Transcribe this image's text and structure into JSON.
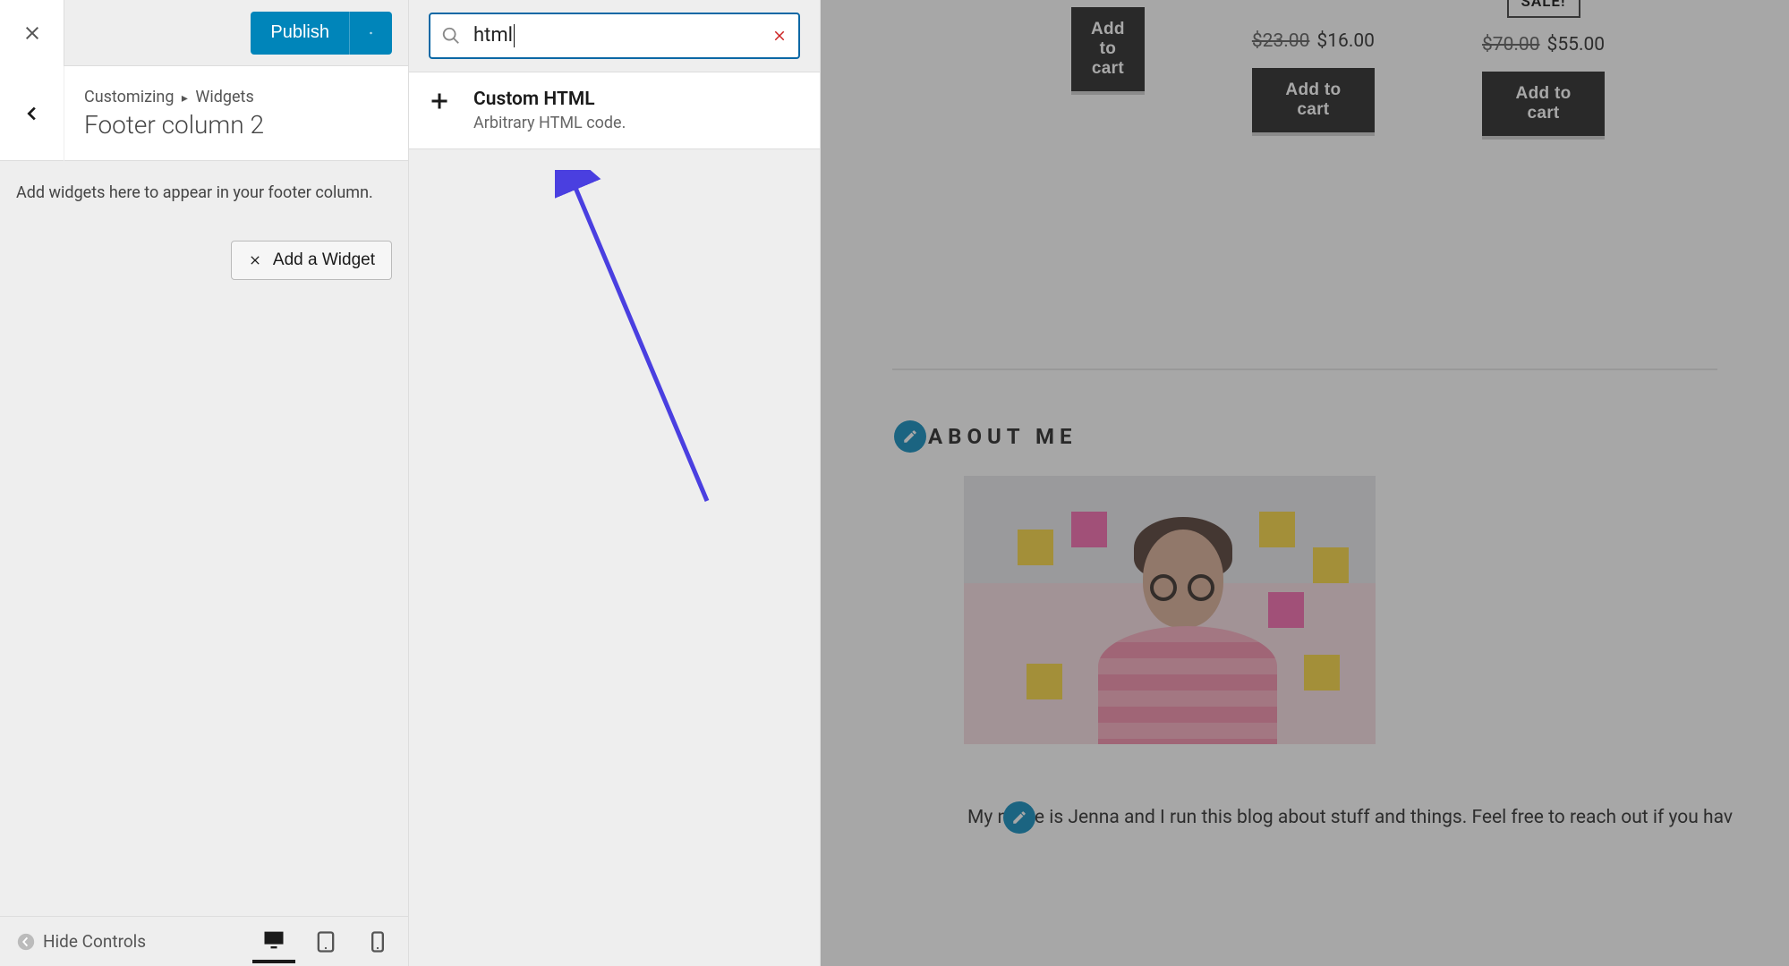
{
  "sidebar": {
    "publish_label": "Publish",
    "breadcrumb_parent": "Customizing",
    "breadcrumb_child": "Widgets",
    "title": "Footer column 2",
    "help_text": "Add widgets here to appear in your footer column.",
    "add_widget_label": "Add a Widget",
    "hide_controls_label": "Hide Controls"
  },
  "widget_panel": {
    "search_value": "html",
    "result_title": "Custom HTML",
    "result_desc": "Arbitrary HTML code."
  },
  "preview": {
    "cart_label": "Add to cart",
    "sale_label": "SALE!",
    "products": [
      {
        "old_price": "",
        "new_price": ""
      },
      {
        "old_price": "$23.00",
        "new_price": "$16.00"
      },
      {
        "old_price": "$70.00",
        "new_price": "$55.00"
      }
    ],
    "about_title": "ABOUT ME",
    "about_text": "My name is Jenna and I run this blog about stuff and things. Feel free to reach out if you hav"
  }
}
